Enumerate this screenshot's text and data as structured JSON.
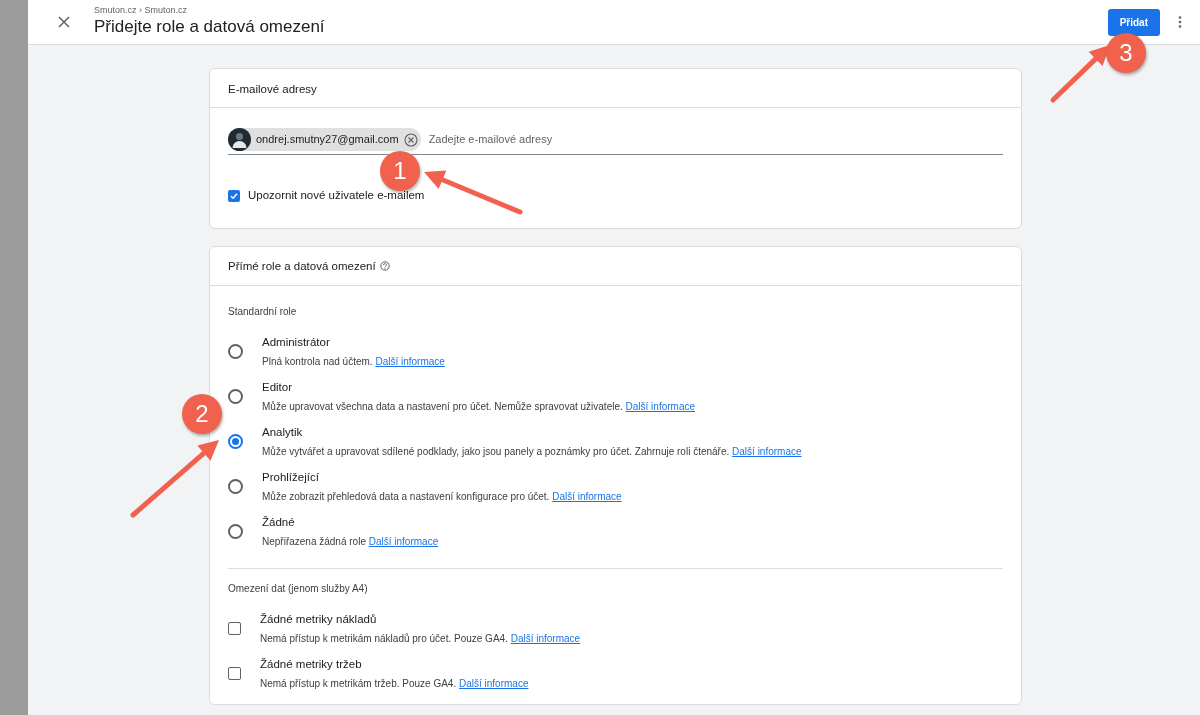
{
  "header": {
    "breadcrumb": "Smuton.cz › Smuton.cz",
    "title": "Přidejte role a datová omezení",
    "add_button": "Přidat"
  },
  "email_card": {
    "title": "E-mailové adresy",
    "chips": [
      {
        "email": "ondrej.smutny27@gmail.com"
      }
    ],
    "placeholder": "Zadejte e-mailové adresy",
    "notify": {
      "label": "Upozornit nové uživatele e-mailem",
      "checked": true
    }
  },
  "roles_card": {
    "title": "Přímé role a datová omezení",
    "section_label": "Standardní role",
    "roles": [
      {
        "name": "Administrátor",
        "description": "Plná kontrola nad účtem.",
        "link": "Další informace",
        "selected": false
      },
      {
        "name": "Editor",
        "description": "Může upravovat všechna data a nastavení pro účet. Nemůže spravovat uživatele.",
        "link": "Další informace",
        "selected": false
      },
      {
        "name": "Analytik",
        "description": "Může vytvářet a upravovat sdílené podklady, jako jsou panely a poznámky pro účet. Zahrnuje roli čtenáře.",
        "link": "Další informace",
        "selected": true
      },
      {
        "name": "Prohlížející",
        "description": "Může zobrazit přehledová data a nastavení konfigurace pro účet.",
        "link": "Další informace",
        "selected": false
      },
      {
        "name": "Žádné",
        "description": "Nepřiřazena žádná role",
        "link": "Další informace",
        "selected": false
      }
    ],
    "restrictions_label": "Omezení dat (jenom služby A4)",
    "restrictions": [
      {
        "name": "Žádné metriky nákladů",
        "description": "Nemá přístup k metrikám nákladů pro účet. Pouze GA4.",
        "link": "Další informace",
        "checked": false
      },
      {
        "name": "Žádné metriky tržeb",
        "description": "Nemá přístup k metrikám tržeb. Pouze GA4.",
        "link": "Další informace",
        "checked": false
      }
    ]
  },
  "annotations": [
    {
      "number": "1"
    },
    {
      "number": "2"
    },
    {
      "number": "3"
    }
  ]
}
